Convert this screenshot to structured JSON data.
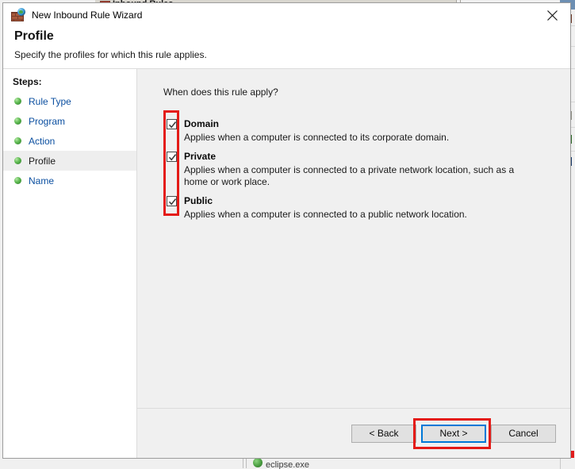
{
  "background": {
    "inbound_rules_label": "Inbound Rules",
    "bottom_item_label": "eclipse.exe"
  },
  "dialog": {
    "titlebar": {
      "title": "New Inbound Rule Wizard",
      "icon": "firewall-globe-icon",
      "close_label": "Close"
    },
    "header": {
      "title": "Profile",
      "subtitle": "Specify the profiles for which this rule applies."
    },
    "steps": {
      "heading": "Steps:",
      "items": [
        {
          "label": "Rule Type",
          "current": false
        },
        {
          "label": "Program",
          "current": false
        },
        {
          "label": "Action",
          "current": false
        },
        {
          "label": "Profile",
          "current": true
        },
        {
          "label": "Name",
          "current": false
        }
      ]
    },
    "content": {
      "question": "When does this rule apply?",
      "profiles": [
        {
          "name": "Domain",
          "checked": true,
          "description": "Applies when a computer is connected to its corporate domain."
        },
        {
          "name": "Private",
          "checked": true,
          "description": "Applies when a computer is connected to a private network location, such as a home or work place."
        },
        {
          "name": "Public",
          "checked": true,
          "description": "Applies when a computer is connected to a public network location."
        }
      ]
    },
    "footer": {
      "back_label": "< Back",
      "next_label": "Next >",
      "cancel_label": "Cancel"
    }
  },
  "annotations": {
    "highlight_color": "#e41b17",
    "focus_color": "#0078d7"
  }
}
